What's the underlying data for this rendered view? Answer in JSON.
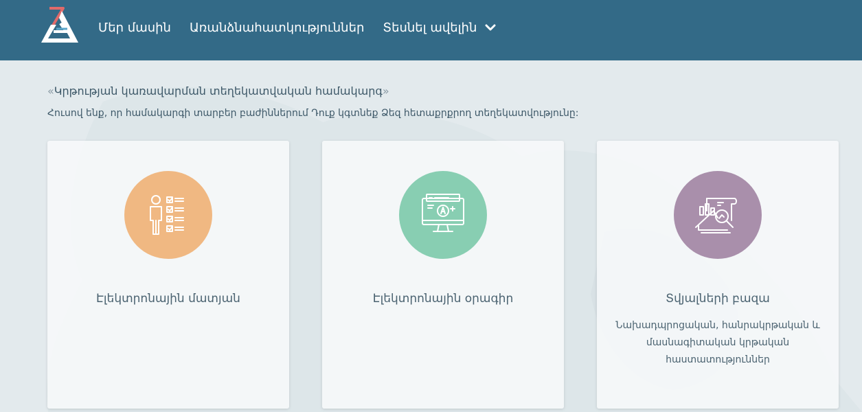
{
  "header": {
    "nav": [
      {
        "label": "Մեր մասին"
      },
      {
        "label": "Առանձնահատկություններ"
      },
      {
        "label": "Տեսնել ավելին"
      }
    ]
  },
  "intro": {
    "open_quote": "«",
    "title": "Կրթության կառավարման տեղեկատվական համակարգ",
    "close_quote": "»",
    "subtitle": "Հուսով ենք, որ համակարգի տարբեր բաժիններում Դուք կգտնեք Ձեզ հետաքրքրող տեղեկատվությունը:"
  },
  "cards": [
    {
      "title": "Էլեկտրոնային մատյան",
      "icon": "person-checklist-icon",
      "color": "#f0b882"
    },
    {
      "title": "Էլեկտրոնային օրագիր",
      "icon": "monitor-grade-icon",
      "color": "#88ceb2"
    },
    {
      "title": "Տվյալների բազա",
      "description": "Նախադպրոցական, հանրակրթական և մասնագիտական կրթական հաստատություններ",
      "icon": "data-analysis-icon",
      "color": "#a98fab"
    }
  ],
  "colors": {
    "header": "#336a87",
    "background": "#e3eaed"
  }
}
